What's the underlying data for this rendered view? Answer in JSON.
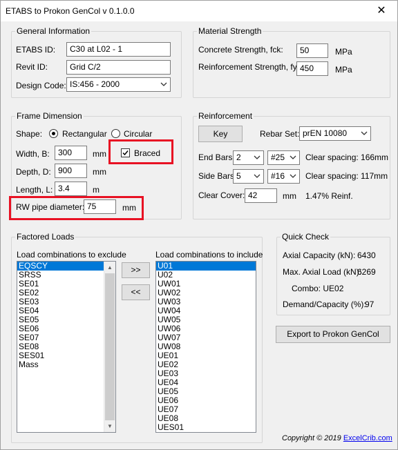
{
  "window": {
    "title": "ETABS to Prokon GenCol v 0.1.0.0",
    "close_glyph": "✕"
  },
  "general": {
    "legend": "General Information",
    "etabs_id_label": "ETABS ID:",
    "etabs_id_value": "C30 at L02 - 1",
    "revit_id_label": "Revit ID:",
    "revit_id_value": "Grid C/2",
    "design_code_label": "Design Code:",
    "design_code_value": "IS:456 - 2000"
  },
  "material": {
    "legend": "Material Strength",
    "concrete_label": "Concrete Strength, fck:",
    "concrete_value": "50",
    "concrete_unit": "MPa",
    "reinf_label": "Reinforcement Strength, fy:",
    "reinf_value": "450",
    "reinf_unit": "MPa"
  },
  "frame": {
    "legend": "Frame Dimension",
    "shape_label": "Shape:",
    "shape_rect": "Rectangular",
    "shape_circ": "Circular",
    "width_label": "Width, B:",
    "width_value": "300",
    "width_unit": "mm",
    "depth_label": "Depth, D:",
    "depth_value": "900",
    "depth_unit": "mm",
    "length_label": "Length, L:",
    "length_value": "3.4",
    "length_unit": "m",
    "braced_label": "Braced",
    "rw_label": "RW pipe diameter:",
    "rw_value": "75",
    "rw_unit": "mm"
  },
  "reinforcement": {
    "legend": "Reinforcement",
    "key_button": "Key",
    "rebar_set_label": "Rebar Set:",
    "rebar_set_value": "prEN 10080",
    "end_bars_label": "End Bars:",
    "end_bars_count": "2",
    "end_bars_size": "#25",
    "end_bars_spacing": "Clear spacing: 166mm",
    "side_bars_label": "Side Bars:",
    "side_bars_count": "5",
    "side_bars_size": "#16",
    "side_bars_spacing": "Clear spacing: 117mm",
    "clear_cover_label": "Clear Cover:",
    "clear_cover_value": "42",
    "clear_cover_unit": "mm",
    "reinf_ratio": "1.47% Reinf."
  },
  "factored": {
    "legend": "Factored Loads",
    "exclude_label": "Load combinations to exclude",
    "include_label": "Load combinations to include",
    "add_button": ">>",
    "remove_button": "<<",
    "exclude_items": [
      "EQSCY",
      "SRSS",
      "SE01",
      "SE02",
      "SE03",
      "SE04",
      "SE05",
      "SE06",
      "SE07",
      "SE08",
      "SES01",
      "Mass"
    ],
    "include_items": [
      "U01",
      "U02",
      "UW01",
      "UW02",
      "UW03",
      "UW04",
      "UW05",
      "UW06",
      "UW07",
      "UW08",
      "UE01",
      "UE02",
      "UE03",
      "UE04",
      "UE05",
      "UE06",
      "UE07",
      "UE08",
      "UES01"
    ]
  },
  "quick_check": {
    "legend": "Quick Check",
    "axial_capacity_label": "Axial Capacity (kN):",
    "axial_capacity_value": "6430",
    "max_axial_label": "Max. Axial Load (kN):",
    "max_axial_value": "6269",
    "combo_text": "Combo: UE02",
    "dc_label": "Demand/Capacity (%):",
    "dc_value": "97"
  },
  "export_button": "Export to Prokon GenCol",
  "footer": {
    "copyright": "Copyright © 2019",
    "link": "ExcelCrib.com"
  },
  "colors": {
    "highlight_box": "#e81123",
    "selection": "#0078d7",
    "link": "#0000ee"
  }
}
